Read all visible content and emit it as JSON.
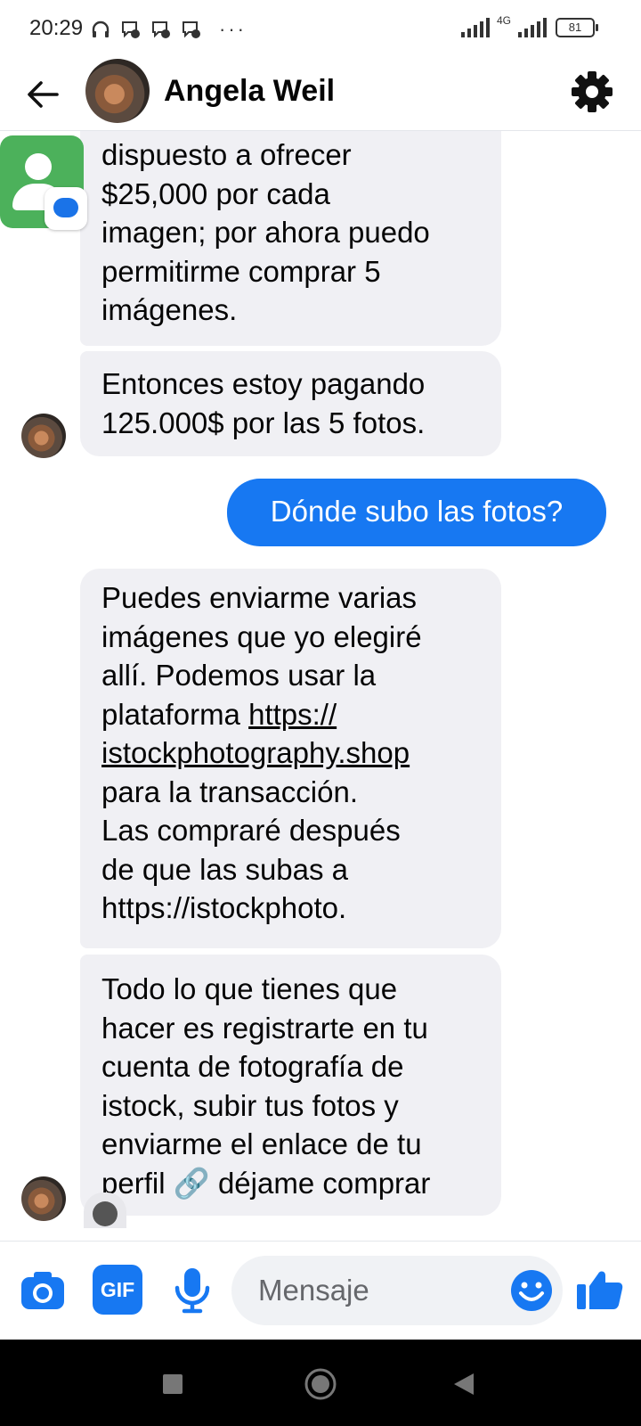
{
  "status_bar": {
    "time": "20:29",
    "network": "4G",
    "battery": "81"
  },
  "header": {
    "contact_name": "Angela Weil"
  },
  "messages": [
    {
      "sender": "them",
      "lines": [
        "dispuesto a ofrecer",
        "$25,000 por cada",
        "imagen; por ahora puedo",
        "permitirme comprar 5",
        "imágenes."
      ]
    },
    {
      "sender": "them",
      "lines": [
        "Entonces estoy pagando",
        "125.000$ por las 5 fotos."
      ]
    },
    {
      "sender": "me",
      "lines": [
        "Dónde subo las fotos?"
      ]
    },
    {
      "sender": "them",
      "lines": [
        "Puedes enviarme varias",
        "imágenes que yo elegiré",
        "allí. Podemos usar la",
        "plataforma ",
        "https://",
        "istockphotography.shop",
        "para la transacción.",
        "Las compraré después",
        "de que las subas a",
        "https://istockphoto."
      ]
    },
    {
      "sender": "them",
      "lines": [
        "Todo lo que tienes que",
        "hacer es registrarte en tu",
        "cuenta de fotografía de",
        "istock, subir tus fotos y",
        "enviarme el enlace de tu",
        "perfil 🔗 déjame comprar"
      ]
    }
  ],
  "composer": {
    "placeholder": "Mensaje",
    "gif_label": "GIF"
  },
  "colors": {
    "accent": "#1778f2",
    "bubble_them": "#f0f0f4",
    "bubble_me": "#1778f2",
    "chathead": "#4cb15b"
  }
}
